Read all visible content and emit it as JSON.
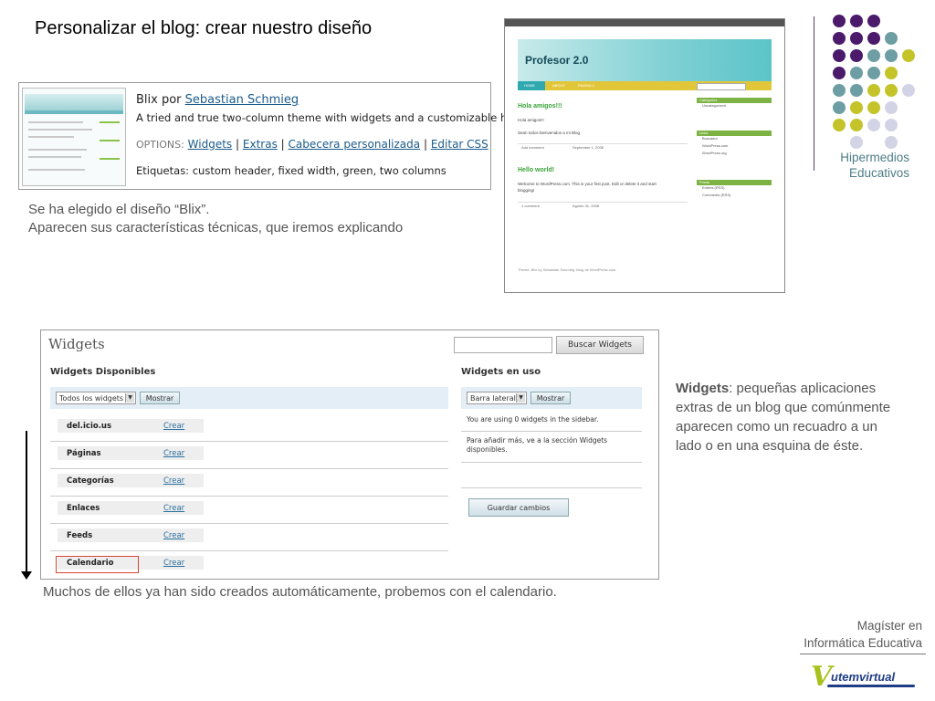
{
  "title": "Personalizar el blog: crear nuestro diseño",
  "blix": {
    "theme_name": "Blix por",
    "author": "Sebastian Schmieg",
    "description": "A tried and true two-column theme with widgets and a customizable header.",
    "options_label": "OPTIONS:",
    "options": [
      "Widgets",
      "Extras",
      "Cabecera personalizada",
      "Editar CSS"
    ],
    "separator": "|",
    "tags": "Etiquetas: custom header, fixed width, green, two columns"
  },
  "caption1": {
    "line1": "Se ha elegido el diseño “Blix”.",
    "line2": "Aparecen sus características técnicas, que iremos explicando"
  },
  "preview": {
    "blog_title": "Profesor 2.0",
    "nav": [
      "HOME",
      "ABOUT",
      "PAGINA 1"
    ],
    "post1_title": "Hola amigos!!!",
    "post1_line1": "Hola amigos!!!",
    "post1_line2": "Sean todos bienvenidos a mi Blog",
    "post1_meta_left": "Add comment",
    "post1_meta_date": "September 1, 2008",
    "post2_title": "Hello world!",
    "post2_line1": "Welcome to WordPress.com. This is your first post. Edit or delete it and start",
    "post2_line2": "blogging!",
    "post2_meta_left": "1 comment",
    "post2_meta_date": "Agosto 31, 2008",
    "sidebar": [
      {
        "header": "Categories",
        "items": [
          "Uncategorized"
        ]
      },
      {
        "header": "Links",
        "items": [
          "Buscador",
          "WordPress.com",
          "WordPress.org"
        ]
      },
      {
        "header": "Feeds",
        "items": [
          "Entries (RSS)",
          "Comments (RSS)"
        ]
      }
    ],
    "footer": "Theme: Blix by Sebastian Schmieg. Blog de WordPress.com."
  },
  "hipermedios": {
    "line1": "Hipermedios",
    "line2": "Educativos"
  },
  "dots": {
    "colors": {
      "purple": "#4b1a6b",
      "teal": "#6d9ea3",
      "lime": "#c4c42a",
      "lavender": "#d3d3e6"
    }
  },
  "widgets": {
    "title": "Widgets",
    "search_button": "Buscar Widgets",
    "available_header": "Widgets Disponibles",
    "filter_select": "Todos los widgets",
    "filter_button": "Mostrar",
    "list": [
      {
        "name": "del.icio.us",
        "action": "Crear"
      },
      {
        "name": "Páginas",
        "action": "Crear"
      },
      {
        "name": "Categorías",
        "action": "Crear"
      },
      {
        "name": "Enlaces",
        "action": "Crear"
      },
      {
        "name": "Feeds",
        "action": "Crear"
      },
      {
        "name": "Calendario",
        "action": "Crear"
      }
    ],
    "in_use_header": "Widgets en uso",
    "sidebar_select": "Barra lateral",
    "sidebar_button": "Mostrar",
    "using_text": "You are using 0 widgets in the sidebar.",
    "add_more_line1": "Para añadir más, ve a la sección Widgets",
    "add_more_line2": "disponibles.",
    "save_button": "Guardar cambios"
  },
  "caption2": "Muchos de ellos ya han sido creados automáticamente, probemos con el calendario.",
  "note": {
    "bold": "Widgets",
    "text": ": pequeñas aplicaciones extras de un blog que comúnmente aparecen como un recuadro a un lado o en una esquina de éste."
  },
  "magister": {
    "line1": "Magíster en",
    "line2": "Informática Educativa"
  },
  "logo": {
    "text": "utemvirtual"
  }
}
